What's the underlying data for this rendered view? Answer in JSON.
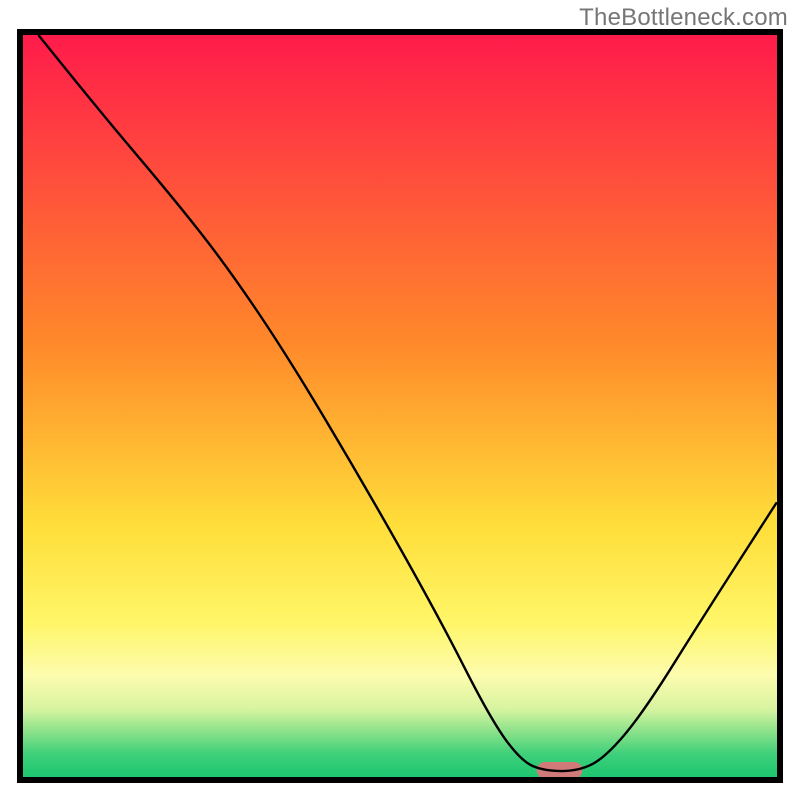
{
  "watermark": "TheBottleneck.com",
  "chart_data": {
    "type": "line",
    "title": "",
    "xlabel": "",
    "ylabel": "",
    "xlim": [
      0,
      100
    ],
    "ylim": [
      0,
      100
    ],
    "grid": false,
    "background": {
      "type": "vertical-gradient",
      "stops": [
        {
          "offset": 0.0,
          "color": "#ff1a4b"
        },
        {
          "offset": 0.42,
          "color": "#ff8a2a"
        },
        {
          "offset": 0.66,
          "color": "#ffde3a"
        },
        {
          "offset": 0.79,
          "color": "#fff668"
        },
        {
          "offset": 0.86,
          "color": "#fdfcae"
        },
        {
          "offset": 0.905,
          "color": "#d7f4a0"
        },
        {
          "offset": 0.935,
          "color": "#8ce28a"
        },
        {
          "offset": 0.965,
          "color": "#3fd07a"
        },
        {
          "offset": 1.0,
          "color": "#18c56f"
        }
      ]
    },
    "axes_color": "#000000",
    "curve": {
      "color": "#000000",
      "width": 2.4,
      "points": [
        {
          "x": 2.5,
          "y": 99.5
        },
        {
          "x": 10.0,
          "y": 90.0
        },
        {
          "x": 20.0,
          "y": 78.0
        },
        {
          "x": 27.0,
          "y": 69.0
        },
        {
          "x": 35.0,
          "y": 57.0
        },
        {
          "x": 45.0,
          "y": 40.0
        },
        {
          "x": 55.0,
          "y": 22.0
        },
        {
          "x": 62.0,
          "y": 8.0
        },
        {
          "x": 66.0,
          "y": 2.5
        },
        {
          "x": 69.0,
          "y": 1.2
        },
        {
          "x": 73.5,
          "y": 1.2
        },
        {
          "x": 77.0,
          "y": 3.0
        },
        {
          "x": 82.0,
          "y": 9.0
        },
        {
          "x": 90.0,
          "y": 22.0
        },
        {
          "x": 99.5,
          "y": 37.0
        }
      ]
    },
    "marker": {
      "x": 71.0,
      "y": 1.3,
      "width": 6.0,
      "height": 2.2,
      "color": "#d07a7a"
    }
  }
}
